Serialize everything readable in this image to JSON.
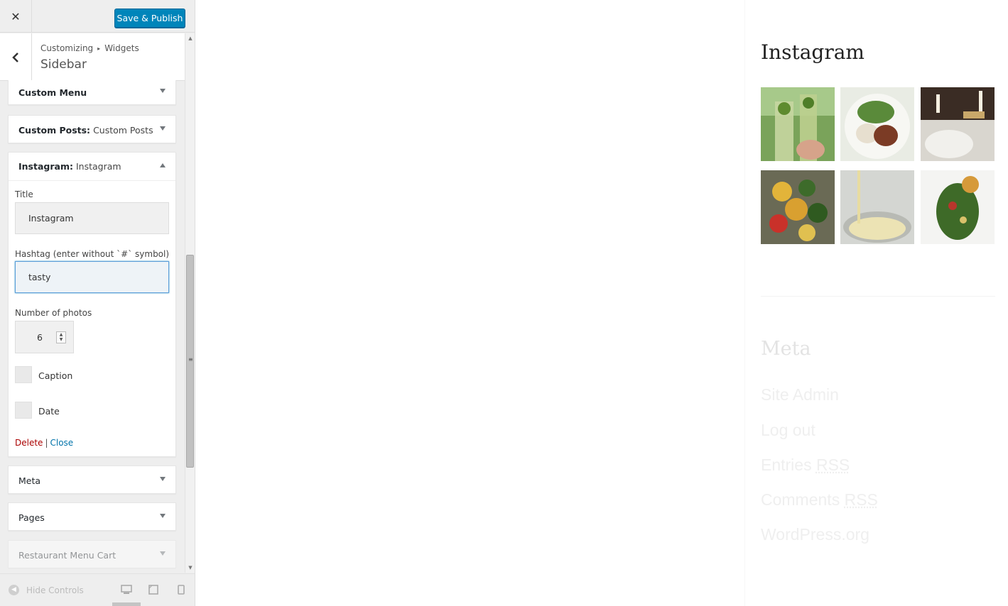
{
  "topbar": {
    "close_icon": "close-icon",
    "publish_label": "Save & Publish"
  },
  "section": {
    "breadcrumb_parent": "Customizing",
    "breadcrumb_child": "Widgets",
    "title": "Sidebar"
  },
  "widgets": {
    "custom_menu": {
      "title": "Custom Menu"
    },
    "custom_posts": {
      "title": "Custom Posts:",
      "subtitle": "Custom Posts"
    },
    "instagram": {
      "title": "Instagram:",
      "subtitle": "Instagram",
      "title_label": "Title",
      "title_value": "Instagram",
      "hashtag_label": "Hashtag (enter without `#` symbol)",
      "hashtag_value": "tasty",
      "photos_label": "Number of photos",
      "photos_value": "6",
      "caption_label": "Caption",
      "date_label": "Date",
      "delete_label": "Delete",
      "separator": "|",
      "close_label": "Close"
    },
    "meta": {
      "title": "Meta"
    },
    "pages": {
      "title": "Pages"
    },
    "restaurant": {
      "title": "Restaurant Menu Cart"
    }
  },
  "footer": {
    "hide_label": "Hide Controls"
  },
  "preview": {
    "instagram_title": "Instagram",
    "photos": [
      "mojito drinks",
      "salad plate",
      "dinner table",
      "pasta salad",
      "pouring cream",
      "leafy salad"
    ],
    "meta_title": "Meta",
    "meta_links": [
      {
        "text": "Site Admin",
        "rss": ""
      },
      {
        "text": "Log out",
        "rss": ""
      },
      {
        "text": "Entries",
        "rss": "RSS"
      },
      {
        "text": "Comments",
        "rss": "RSS"
      },
      {
        "text": "WordPress.org",
        "rss": ""
      }
    ]
  },
  "colors": {
    "accent": "#0085ba",
    "delete": "#aa0000",
    "link": "#0073aa",
    "panel_bg": "#eeeeee"
  }
}
